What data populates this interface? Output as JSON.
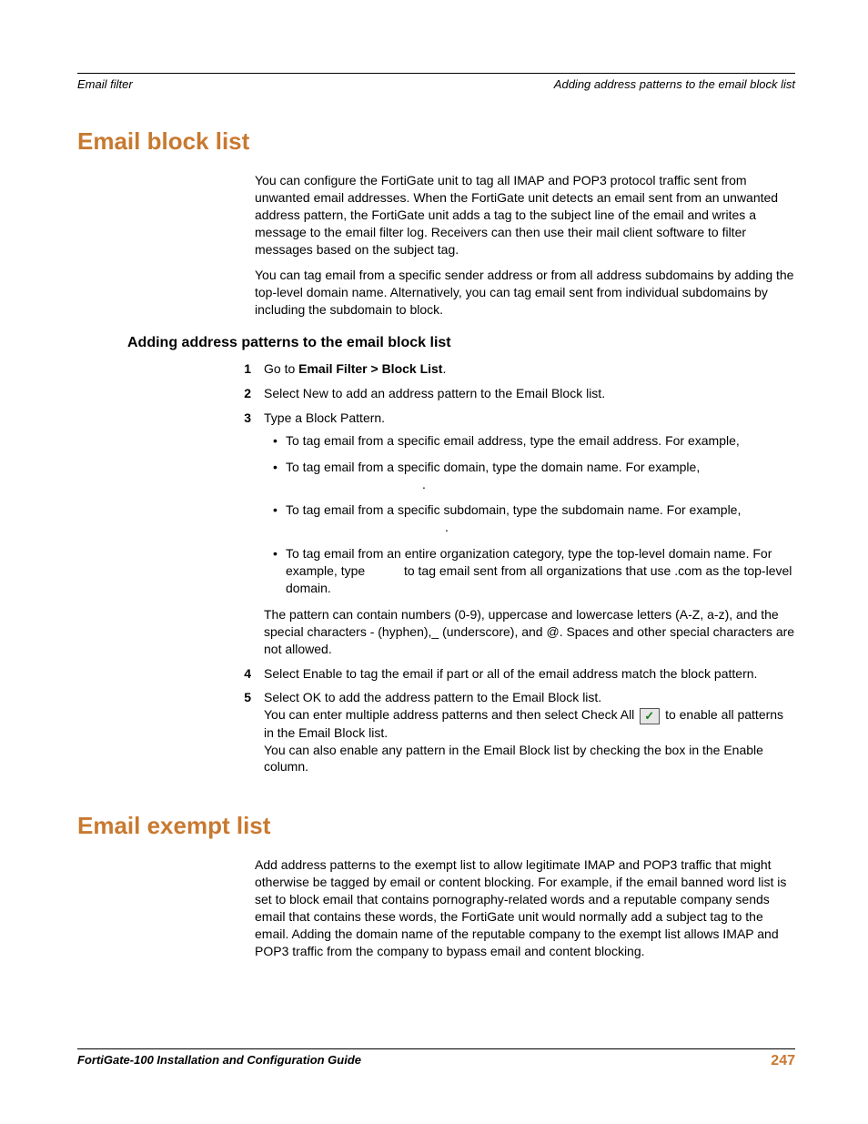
{
  "header": {
    "left": "Email filter",
    "right": "Adding address patterns to the email block list"
  },
  "section1": {
    "title": "Email block list",
    "p1": "You can configure the FortiGate unit to tag all IMAP and POP3 protocol traffic sent from unwanted email addresses. When the FortiGate unit detects an email sent from an unwanted address pattern, the FortiGate unit adds a tag to the subject line of the email and writes a message to the email filter log. Receivers can then use their mail client software to filter messages based on the subject tag.",
    "p2": "You can tag email from a specific sender address or from all address subdomains by adding the top-level domain name. Alternatively, you can tag email sent from individual subdomains by including the subdomain to block.",
    "subheading": "Adding address patterns to the email block list",
    "steps": {
      "s1_pre": "Go to ",
      "s1_bold": "Email Filter > Block List",
      "s1_post": ".",
      "s2": "Select New to add an address pattern to the Email Block list.",
      "s3": "Type a Block Pattern.",
      "s3_b1": "To tag email from a specific email address, type the email address. For example,",
      "s3_b2a": "To tag email from a specific domain, type the domain name. For example,",
      "s3_b2b": ".",
      "s3_b3a": "To tag email from a specific subdomain, type the subdomain name. For example,",
      "s3_b3b": ".",
      "s3_b4a": "To tag email from an entire organization category, type the top-level domain name. For example, type ",
      "s3_b4b": " to tag email sent from all organizations that use .com as the top-level domain.",
      "s3_note": "The pattern can contain numbers (0-9), uppercase and lowercase letters (A-Z, a-z), and the special characters - (hyphen),_ (underscore), and @. Spaces and other special characters are not allowed.",
      "s4": "Select Enable to tag the email if part or all of the email address match the block pattern.",
      "s5a": "Select OK to add the address pattern to the Email Block list.",
      "s5b_pre": "You can enter multiple address patterns and then select Check All ",
      "s5b_post": " to enable all patterns in the Email Block list.",
      "s5c": "You can also enable any pattern in the Email Block list by checking the box in the Enable column."
    }
  },
  "section2": {
    "title": "Email exempt list",
    "p1": "Add address patterns to the exempt list to allow legitimate IMAP and POP3 traffic that might otherwise be tagged by email or content blocking. For example, if the email banned word list is set to block email that contains pornography-related words and a reputable company sends email that contains these words, the FortiGate unit would normally add a subject tag to the email. Adding the domain name of the reputable company to the exempt list allows IMAP and POP3 traffic from the company to bypass email and content blocking."
  },
  "footer": {
    "left": "FortiGate-100 Installation and Configuration Guide",
    "page": "247"
  }
}
